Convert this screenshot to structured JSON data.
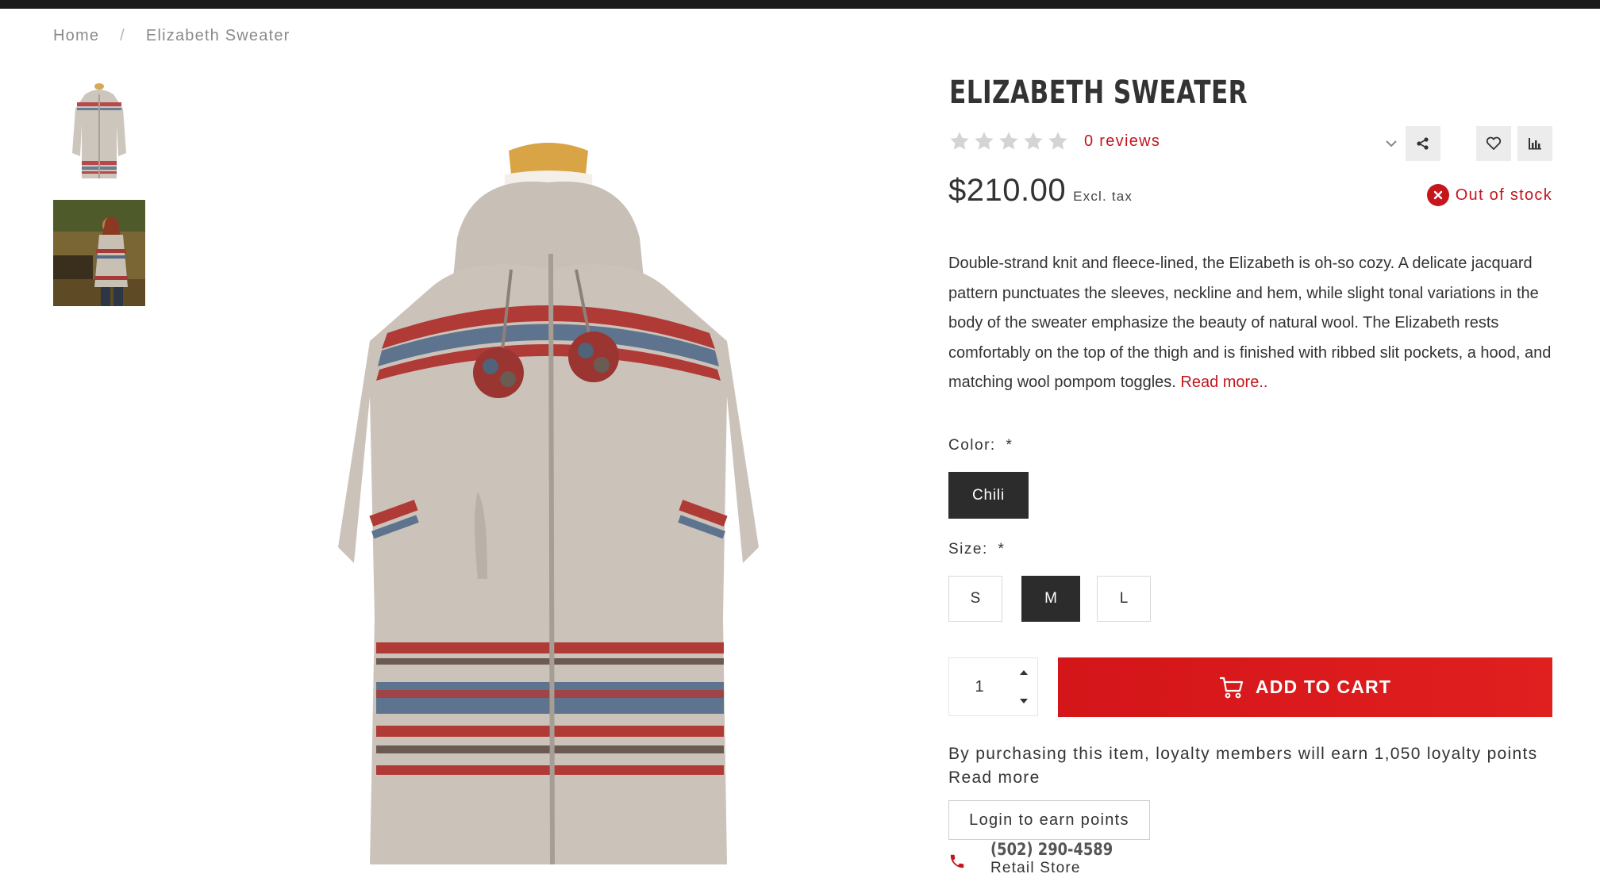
{
  "breadcrumb": {
    "home": "Home",
    "separator": "/",
    "current": "Elizabeth Sweater"
  },
  "product": {
    "title": "ELIZABETH SWEATER",
    "rating_stars": 0,
    "reviews_label": "0 reviews",
    "price": "$210.00",
    "tax_note": "Excl. tax",
    "stock_status": "Out of stock",
    "description": "Double-strand knit and fleece-lined, the Elizabeth is oh-so cozy. A delicate jacquard pattern punctuates the sleeves, neckline and hem, while slight tonal variations in the body of the sweater emphasize the beauty of natural wool. The Elizabeth rests comfortably on the top of the thigh and is finished with ribbed slit pockets, a hood, and matching wool pompom toggles.",
    "read_more": "Read more.."
  },
  "actions": {
    "share_icon": "share-icon",
    "wishlist_icon": "heart-icon",
    "compare_icon": "bar-chart-icon",
    "dropdown_icon": "chevron-down-icon"
  },
  "options": {
    "color_label": "Color:",
    "required_mark": "*",
    "color_selected": "Chili",
    "size_label": "Size:",
    "sizes": [
      "S",
      "M",
      "L"
    ],
    "size_selected": "M"
  },
  "cart": {
    "quantity": "1",
    "add_to_cart": "ADD TO CART"
  },
  "loyalty": {
    "text": "By purchasing this item, loyalty members will earn 1,050 loyalty points",
    "read_more": "Read more",
    "login_button": "Login to earn points"
  },
  "contact": {
    "phone": "(502) 290-4589",
    "label": "Retail Store"
  },
  "colors": {
    "accent_red": "#c4161c",
    "dark_button": "#2c2c2c",
    "topbar": "#1a1a1a"
  }
}
